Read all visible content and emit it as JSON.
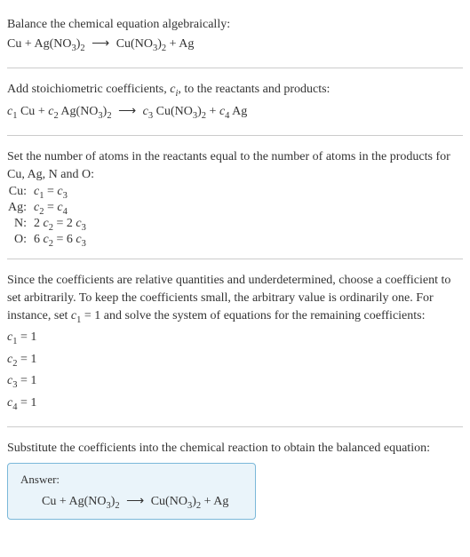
{
  "section1": {
    "title": "Balance the chemical equation algebraically:",
    "eq_lhs1": "Cu",
    "eq_plus": " + ",
    "eq_lhs2a": "Ag(NO",
    "eq_lhs2b": "3",
    "eq_lhs2c": ")",
    "eq_lhs2d": "2",
    "eq_arrow": "⟶",
    "eq_rhs1a": "Cu(NO",
    "eq_rhs1b": "3",
    "eq_rhs1c": ")",
    "eq_rhs1d": "2",
    "eq_rhs2": "Ag"
  },
  "section2": {
    "title_a": "Add stoichiometric coefficients, ",
    "title_b": "c",
    "title_c": "i",
    "title_d": ", to the reactants and products:",
    "c1": "c",
    "c1s": "1",
    "t1": " Cu",
    "c2": "c",
    "c2s": "2",
    "t2a": " Ag(NO",
    "t2b": "3",
    "t2c": ")",
    "t2d": "2",
    "arrow": "⟶",
    "c3": "c",
    "c3s": "3",
    "t3a": " Cu(NO",
    "t3b": "3",
    "t3c": ")",
    "t3d": "2",
    "c4": "c",
    "c4s": "4",
    "t4": " Ag"
  },
  "section3": {
    "title": "Set the number of atoms in the reactants equal to the number of atoms in the products for Cu, Ag, N and O:",
    "rows": [
      {
        "label": "Cu:",
        "lhs_coef": "",
        "lhs_c": "c",
        "lhs_s": "1",
        "eq": " = ",
        "rhs_coef": "",
        "rhs_c": "c",
        "rhs_s": "3"
      },
      {
        "label": "Ag:",
        "lhs_coef": "",
        "lhs_c": "c",
        "lhs_s": "2",
        "eq": " = ",
        "rhs_coef": "",
        "rhs_c": "c",
        "rhs_s": "4"
      },
      {
        "label": "N:",
        "lhs_coef": "2 ",
        "lhs_c": "c",
        "lhs_s": "2",
        "eq": " = ",
        "rhs_coef": "2 ",
        "rhs_c": "c",
        "rhs_s": "3"
      },
      {
        "label": "O:",
        "lhs_coef": "6 ",
        "lhs_c": "c",
        "lhs_s": "2",
        "eq": " = ",
        "rhs_coef": "6 ",
        "rhs_c": "c",
        "rhs_s": "3"
      }
    ]
  },
  "section4": {
    "text_a": "Since the coefficients are relative quantities and underdetermined, choose a coefficient to set arbitrarily. To keep the coefficients small, the arbitrary value is ordinarily one. For instance, set ",
    "text_b": "c",
    "text_c": "1",
    "text_d": " = 1 and solve the system of equations for the remaining coefficients:",
    "coefs": [
      {
        "c": "c",
        "s": "1",
        "v": " = 1"
      },
      {
        "c": "c",
        "s": "2",
        "v": " = 1"
      },
      {
        "c": "c",
        "s": "3",
        "v": " = 1"
      },
      {
        "c": "c",
        "s": "4",
        "v": " = 1"
      }
    ]
  },
  "section5": {
    "title": "Substitute the coefficients into the chemical reaction to obtain the balanced equation:",
    "answer_label": "Answer:",
    "eq_lhs1": "Cu",
    "eq_plus": " + ",
    "eq_lhs2a": "Ag(NO",
    "eq_lhs2b": "3",
    "eq_lhs2c": ")",
    "eq_lhs2d": "2",
    "eq_arrow": "⟶",
    "eq_rhs1a": "Cu(NO",
    "eq_rhs1b": "3",
    "eq_rhs1c": ")",
    "eq_rhs1d": "2",
    "eq_rhs2": "Ag"
  }
}
